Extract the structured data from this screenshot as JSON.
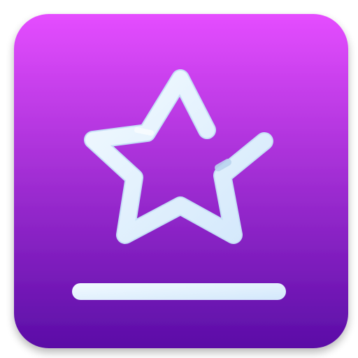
{
  "app_icon": {
    "icon": "star-icon",
    "underline": "baseline-bar",
    "colors": {
      "tile_top": "#e54dff",
      "tile_bottom": "#5a0da6",
      "glyph_light": "#f2faff",
      "glyph_shade": "#c6dff6"
    }
  }
}
